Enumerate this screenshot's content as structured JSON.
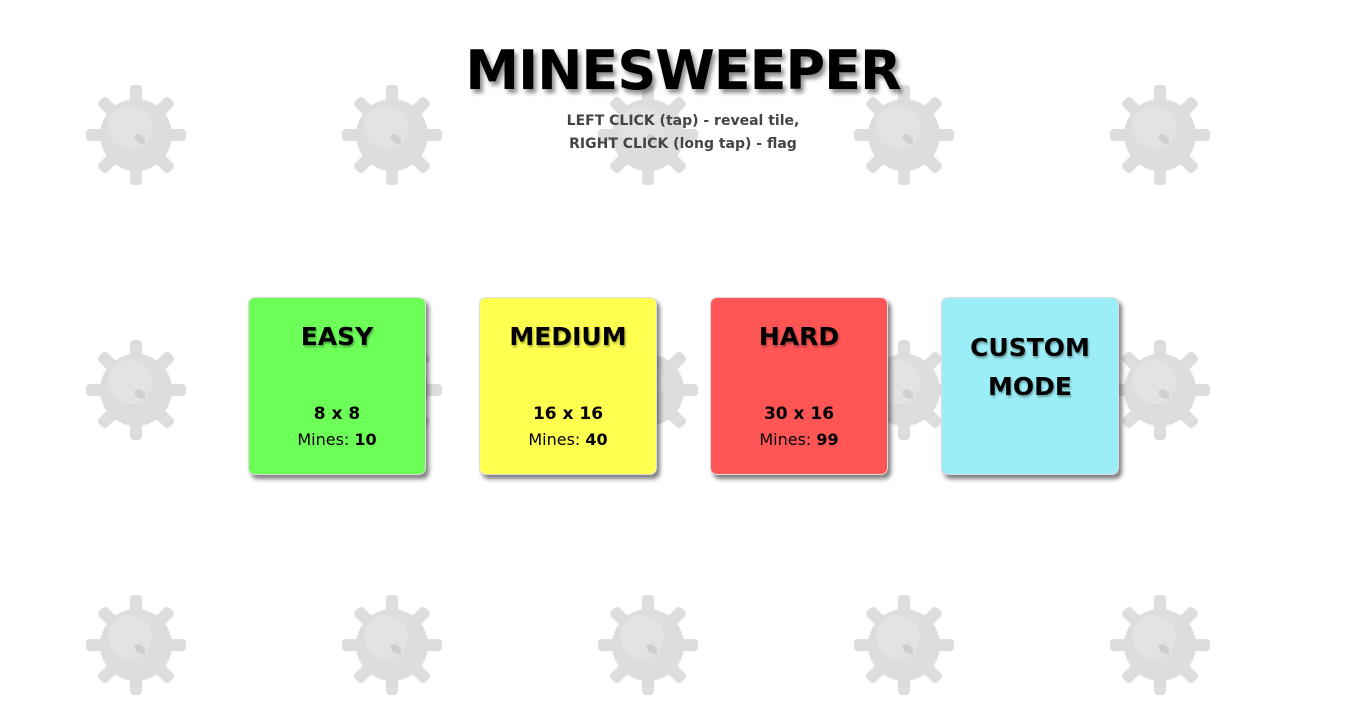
{
  "title": "MINESWEEPER",
  "instructions": [
    "LEFT CLICK (tap) - reveal tile,",
    "RIGHT CLICK (long tap) - flag"
  ],
  "modes": [
    {
      "name": "EASY",
      "size": "8 x 8",
      "mines_label": "Mines:",
      "mines": "10",
      "color": "#6cff58"
    },
    {
      "name": "MEDIUM",
      "size": "16 x 16",
      "mines_label": "Mines:",
      "mines": "40",
      "color": "#ffff50"
    },
    {
      "name": "HARD",
      "size": "30 x 16",
      "mines_label": "Mines:",
      "mines": "99",
      "color": "#ff5555"
    },
    {
      "name": "CUSTOM MODE",
      "color": "#9beef7"
    }
  ],
  "background_icon": "mine-icon"
}
